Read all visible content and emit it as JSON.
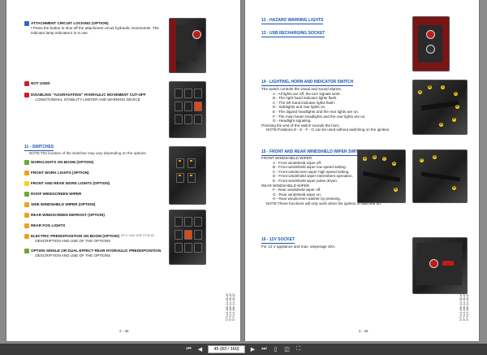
{
  "left_page": {
    "attachment_locking": {
      "title": "ATTACHMENT CIRCUIT LOCKING (OPTION)",
      "text": "• Press the button to shut off the attachment circuit hydraulic movements. The indicator lamp indicates it is in use."
    },
    "not_used": "NOT USED",
    "disabling": {
      "title": "DISABLING \"AGGRAVATING\" HYDRAULIC MOVEMENT CUT-OFF",
      "text": "☞ LONGITUDINAL STABILITY LIMITER AND WARNING DEVICE"
    },
    "switches_head": "11 - SWITCHES",
    "switches_note": "NOTE:The location of the switches may vary depending on the options.",
    "items": [
      {
        "label": "WORKLIGHTS ON BOOM (OPTION)",
        "color": "#6ca63a"
      },
      {
        "label": "FRONT WORK LIGHTS (OPTION)",
        "color": "#f0a020"
      },
      {
        "label": "FRONT AND REAR WORK LIGHTS (OPTION)",
        "color": "#f4d21e"
      },
      {
        "label": "ROOF WINDSCREEN WIPER",
        "color": "#6ca63a"
      },
      {
        "label": "SIDE WINDSHIELD WIPER (OPTION)",
        "color": "#f0a020"
      },
      {
        "label": "REAR WINDSCREEN DEFROST (OPTION)",
        "color": "#f0a020"
      },
      {
        "label": "REAR FOG LIGHTS",
        "color": "#f0a020"
      }
    ],
    "electric_predisposition": {
      "title": "ELECTRIC PREDISPOSITION ON BOOM (OPTION)",
      "models": "MT-X 1440 100P ST3A S2",
      "text": "☞ DESCRIPTION AND USE OF THE OPTIONS"
    },
    "rear_hydraulic": {
      "title": "OPTION SINGLE OR DUAL EFFECT REAR HYDRAULIC PREDISPOSITION",
      "text": "☞ DESCRIPTION AND USE OF THE OPTIONS"
    },
    "page_number": "2 - 45",
    "side_code": "57Y4/1-MH-12-08-AT\n57Y4/1-MH-12-08-AT\n57Y4/1-MH-12-08-AT"
  },
  "right_page": {
    "hazard_head": "12 - HAZARD WARNING LIGHTS",
    "usb_head": "13 - USB RECHARGING SOCKET",
    "lighting_head": "14 - LIGHTING, HORN AND INDICATOR SWITCH",
    "lighting_intro": "The switch controls the visual and sound alarms.",
    "lighting_items": [
      "A - All lights are off, the turn signals work.",
      "B - The right hand indicator lights flash.",
      "C - The left hand indicator lights flash.",
      "D - Sidelights and rear lights on.",
      "E - The dipped headlights and the rear lights are on.",
      "F - The main beam headlights and the rear lights are on.",
      "G - Headlight signaling."
    ],
    "lighting_press": "Pressing the end of the switch sounds the horn.",
    "lighting_note": "NOTE:Positions D - E - F - G can be used without switching on the ignition.",
    "wiper_head": "15 - FRONT AND REAR WINDSHIELD WIPER SWITCH",
    "front_wiper_label": "FRONT WINDSHIELD WIPER",
    "front_wiper_items": [
      "A - Front windshield wiper off.",
      "B - Front windshield wiper low speed setting.",
      "C - Front windscreen wiper high speed setting.",
      "D - Front windshield wiper intermittent operation.",
      "E - Front windshield wiper pulse driven."
    ],
    "rear_wiper_label": "REAR WINDSHIELD WIPER",
    "rear_wiper_items": [
      "F - Rear windshield wiper off.",
      "G - Rear windshield wiper on.",
      "H - Rear windscreen washer by pressing."
    ],
    "wiper_note": "NOTE:These functions will only work when the ignition is switched on.",
    "socket_head": "16 - 12V SOCKET",
    "socket_text": "For 12 V appliance and max. amperage 20A.",
    "page_number": "2 - 46",
    "side_code": "57Y4/1-MH-12-08-AT\n57Y4/1-MH-12-08-AT\n57Y4/1-MH-12-08-AT"
  },
  "toolbar": {
    "page_field": "45 (83 / 160)"
  }
}
